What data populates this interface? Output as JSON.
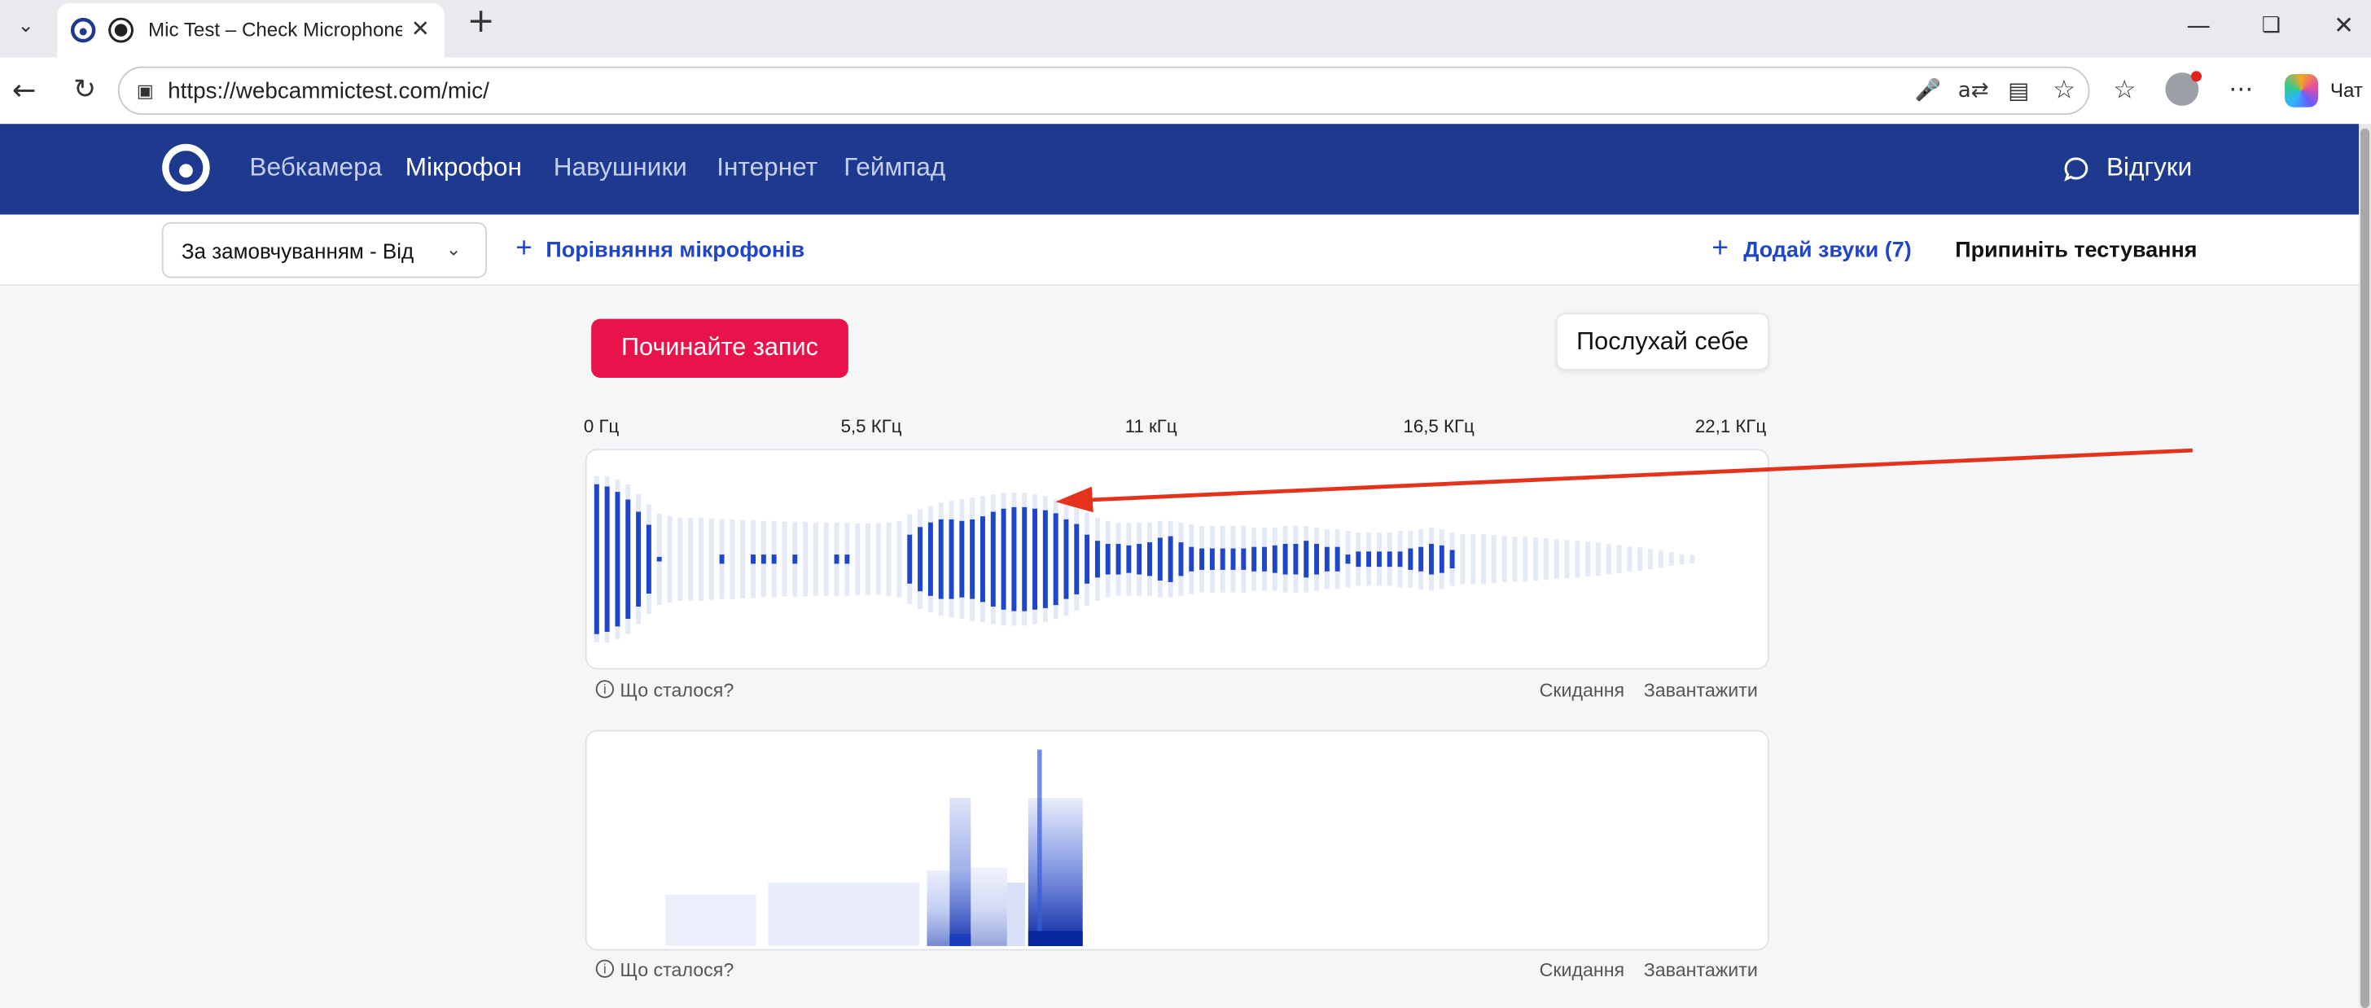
{
  "browser": {
    "tab_title": "Mic Test – Check Microphone",
    "url": "https://webcammictest.com/mic/",
    "chat_label": "Чат",
    "new_tab_icon": "plus-icon",
    "close_tab_icon": "close-icon"
  },
  "site": {
    "nav": {
      "items": [
        "Вебкамера",
        "Мікрофон",
        "Навушники",
        "Інтернет",
        "Геймпад"
      ],
      "active": "Мікрофон",
      "feedback": "Відгуки"
    },
    "subbar": {
      "device_select": "За замовчуванням - Від",
      "compare": "Порівняння мікрофонів",
      "add_sounds": "Додай звуки (7)",
      "stop_testing": "Припиніть тестування"
    },
    "record_button": "Починайте запис",
    "listen_button": "Послухай себе",
    "freq_labels": [
      "0 Гц",
      "5,5 КГц",
      "11 кГц",
      "16,5 КГц",
      "22,1 КГц"
    ],
    "panel_footer": {
      "what_happened": "Що сталося?",
      "reset": "Скидання",
      "download": "Завантажити"
    },
    "colors": {
      "nav_bg": "#1d3a8f",
      "accent_blue": "#1f45c8",
      "record_red": "#e8134a",
      "annotation_red": "#e4321c"
    }
  },
  "chart_data": {
    "type": "bar",
    "title": "",
    "x_range_labels": [
      "0 Гц",
      "5,5 КГц",
      "11 кГц",
      "16,5 КГц",
      "22,1 КГц"
    ],
    "series": [
      {
        "values": [
          0.98,
          0.95,
          0.88,
          0.78,
          0.62,
          0.45,
          0.02,
          0.0,
          0.0,
          0.0,
          0.0,
          0.0,
          0.06,
          0.0,
          0.0,
          0.06,
          0.06,
          0.06,
          0.0,
          0.06,
          0.0,
          0.0,
          0.0,
          0.06,
          0.06,
          0.0,
          0.0,
          0.0,
          0.0,
          0.0,
          0.32,
          0.42,
          0.48,
          0.52,
          0.52,
          0.5,
          0.52,
          0.56,
          0.62,
          0.66,
          0.68,
          0.68,
          0.66,
          0.64,
          0.6,
          0.52,
          0.46,
          0.32,
          0.24,
          0.2,
          0.2,
          0.18,
          0.2,
          0.22,
          0.28,
          0.3,
          0.22,
          0.16,
          0.14,
          0.14,
          0.14,
          0.14,
          0.14,
          0.16,
          0.16,
          0.18,
          0.2,
          0.2,
          0.24,
          0.2,
          0.16,
          0.16,
          0.06,
          0.1,
          0.1,
          0.1,
          0.1,
          0.1,
          0.14,
          0.16,
          0.2,
          0.18,
          0.12,
          0.0,
          0.0,
          0.0,
          0.0,
          0.0,
          0.0,
          0.0,
          0.0,
          0.0,
          0.0,
          0.0,
          0.0,
          0.0,
          0.0,
          0.0,
          0.0,
          0.0,
          0.0,
          0.0,
          0.0,
          0.0,
          0.0,
          0.0
        ],
        "peaks": [
          1.0,
          1.0,
          0.96,
          0.9,
          0.78,
          0.66,
          0.55,
          0.52,
          0.5,
          0.5,
          0.5,
          0.49,
          0.48,
          0.48,
          0.47,
          0.47,
          0.46,
          0.46,
          0.45,
          0.45,
          0.45,
          0.44,
          0.44,
          0.44,
          0.44,
          0.43,
          0.43,
          0.43,
          0.44,
          0.46,
          0.54,
          0.6,
          0.64,
          0.68,
          0.7,
          0.72,
          0.74,
          0.76,
          0.78,
          0.8,
          0.8,
          0.8,
          0.78,
          0.76,
          0.72,
          0.68,
          0.62,
          0.56,
          0.5,
          0.46,
          0.44,
          0.44,
          0.44,
          0.44,
          0.46,
          0.46,
          0.44,
          0.42,
          0.4,
          0.4,
          0.4,
          0.4,
          0.4,
          0.38,
          0.38,
          0.38,
          0.4,
          0.4,
          0.4,
          0.38,
          0.36,
          0.36,
          0.34,
          0.32,
          0.32,
          0.32,
          0.32,
          0.34,
          0.34,
          0.36,
          0.38,
          0.36,
          0.32,
          0.3,
          0.3,
          0.3,
          0.29,
          0.28,
          0.27,
          0.27,
          0.26,
          0.25,
          0.24,
          0.23,
          0.22,
          0.21,
          0.2,
          0.18,
          0.17,
          0.15,
          0.14,
          0.12,
          0.1,
          0.08,
          0.06,
          0.05
        ]
      }
    ]
  }
}
